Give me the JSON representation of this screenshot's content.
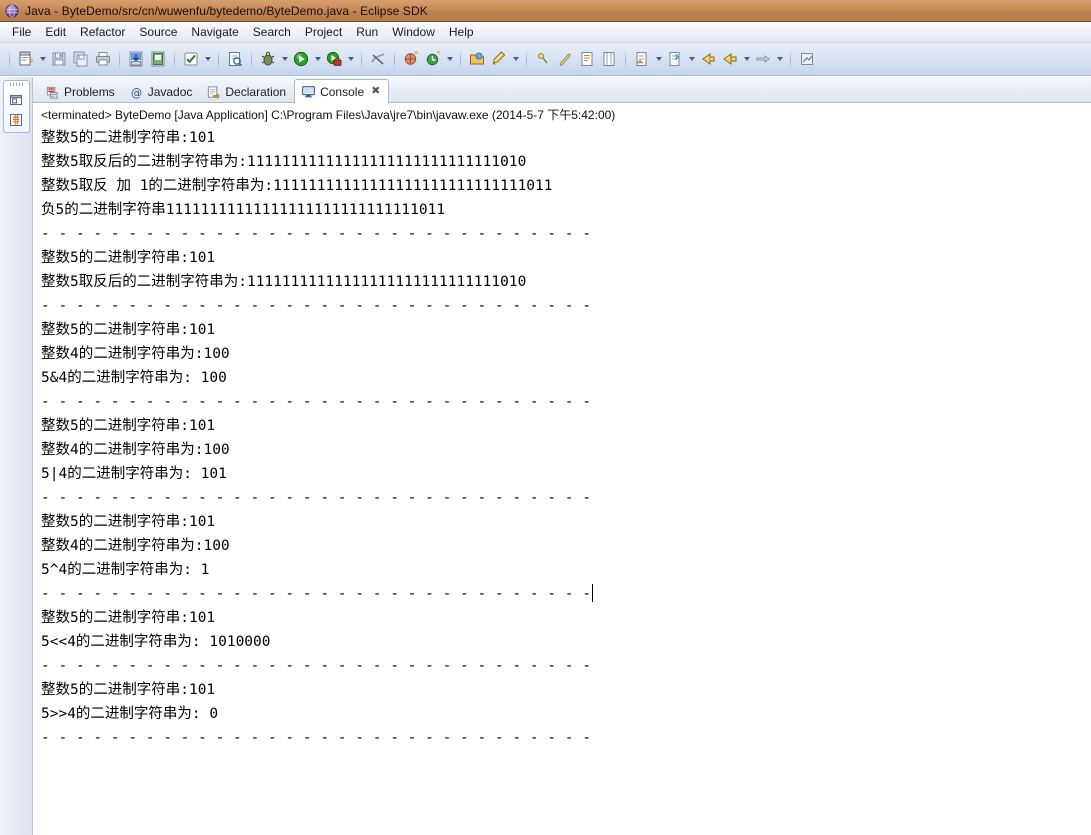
{
  "window": {
    "title": "Java - ByteDemo/src/cn/wuwenfu/bytedemo/ByteDemo.java - Eclipse SDK",
    "app_icon": "eclipse-globe-icon"
  },
  "menubar": {
    "items": [
      {
        "label": "File"
      },
      {
        "label": "Edit"
      },
      {
        "label": "Refactor"
      },
      {
        "label": "Source"
      },
      {
        "label": "Navigate"
      },
      {
        "label": "Search"
      },
      {
        "label": "Project"
      },
      {
        "label": "Run"
      },
      {
        "label": "Window"
      },
      {
        "label": "Help"
      }
    ]
  },
  "toolbar": {
    "groups": [
      {
        "buttons": [
          {
            "icon": "new-wizard-icon",
            "dropdown": true
          },
          {
            "icon": "save-icon",
            "dropdown": false
          },
          {
            "icon": "save-all-icon",
            "dropdown": false
          },
          {
            "icon": "print-icon",
            "dropdown": false
          }
        ]
      },
      {
        "buttons": [
          {
            "icon": "import-icon",
            "dropdown": false
          },
          {
            "icon": "export-icon",
            "dropdown": false
          }
        ]
      },
      {
        "buttons": [
          {
            "icon": "build-all-icon",
            "dropdown": true
          }
        ]
      },
      {
        "buttons": [
          {
            "icon": "open-type-icon",
            "dropdown": false
          }
        ]
      },
      {
        "buttons": [
          {
            "icon": "debug-icon",
            "dropdown": true
          },
          {
            "icon": "run-icon",
            "dropdown": true
          },
          {
            "icon": "external-tools-icon",
            "dropdown": true
          }
        ]
      },
      {
        "buttons": [
          {
            "icon": "skip-breakpoints-icon",
            "dropdown": false
          }
        ]
      },
      {
        "buttons": [
          {
            "icon": "new-java-package-icon",
            "dropdown": false
          },
          {
            "icon": "new-java-class-icon",
            "dropdown": true
          }
        ]
      },
      {
        "buttons": [
          {
            "icon": "open-task-icon",
            "dropdown": false
          },
          {
            "icon": "search-icon",
            "dropdown": true
          }
        ]
      },
      {
        "buttons": [
          {
            "icon": "next-annotation-icon",
            "dropdown": false
          },
          {
            "icon": "previous-annotation-icon",
            "dropdown": false
          },
          {
            "icon": "last-edit-location-icon",
            "dropdown": false
          },
          {
            "icon": "toggle-mark-occurrences-icon",
            "dropdown": false
          }
        ]
      },
      {
        "buttons": [
          {
            "icon": "back-history-icon",
            "dropdown": true
          },
          {
            "icon": "forward-history-icon",
            "dropdown": true
          }
        ]
      },
      {
        "buttons": [
          {
            "icon": "previous-edit-icon",
            "dropdown": false
          },
          {
            "icon": "back-arrow-icon",
            "dropdown": true
          },
          {
            "icon": "forward-arrow-icon",
            "dropdown": true
          }
        ]
      },
      {
        "buttons": [
          {
            "icon": "pin-console-icon",
            "dropdown": false
          }
        ]
      }
    ]
  },
  "fastview": {
    "items": [
      {
        "icon": "restore-perspective-icon"
      },
      {
        "icon": "package-explorer-icon"
      }
    ]
  },
  "view_tabs": [
    {
      "label": "Problems",
      "icon": "problems-icon",
      "active": false,
      "closable": false
    },
    {
      "label": "Javadoc",
      "icon": "javadoc-at-icon",
      "active": false,
      "closable": false
    },
    {
      "label": "Declaration",
      "icon": "declaration-icon",
      "active": false,
      "closable": false
    },
    {
      "label": "Console",
      "icon": "console-icon",
      "active": true,
      "closable": true,
      "close_glyph": "✖"
    }
  ],
  "console": {
    "launch_header": "<terminated> ByteDemo [Java Application] C:\\Program Files\\Java\\jre7\\bin\\javaw.exe (2014-5-7 下午5:42:00)",
    "separator": "- - - - - - - - - - - - - - - - - - - - - - - - - - - - - - - -",
    "lines": [
      "整数5的二进制字符串:101",
      "整数5取反后的二进制字符串为:11111111111111111111111111111010",
      "整数5取反 加 1的二进制字符串为:11111111111111111111111111111011",
      "负5的二进制字符串11111111111111111111111111111011",
      "- - - - - - - - - - - - - - - - - - - - - - - - - - - - - - - -",
      "整数5的二进制字符串:101",
      "整数5取反后的二进制字符串为:11111111111111111111111111111010",
      "- - - - - - - - - - - - - - - - - - - - - - - - - - - - - - - -",
      "整数5的二进制字符串:101",
      "整数4的二进制字符串为:100",
      "5&4的二进制字符串为: 100",
      "- - - - - - - - - - - - - - - - - - - - - - - - - - - - - - - -",
      "整数5的二进制字符串:101",
      "整数4的二进制字符串为:100",
      "5|4的二进制字符串为: 101",
      "- - - - - - - - - - - - - - - - - - - - - - - - - - - - - - - -",
      "整数5的二进制字符串:101",
      "整数4的二进制字符串为:100",
      "5^4的二进制字符串为: 1",
      "- - - - - - - - - - - - - - - - - - - - - - - - - - - - - - - -",
      "整数5的二进制字符串:101",
      "5<<4的二进制字符串为: 1010000",
      "- - - - - - - - - - - - - - - - - - - - - - - - - - - - - - - -",
      "整数5的二进制字符串:101",
      "5>>4的二进制字符串为: 0",
      "- - - - - - - - - - - - - - - - - - - - - - - - - - - - - - - -"
    ],
    "caret_on_line_index": 19
  },
  "colors": {
    "titlebar_start": "#d79f6e",
    "titlebar_end": "#b97b49",
    "toolbar_start": "#e8eef8",
    "toolbar_end": "#c4d3ec",
    "tab_active_bg": "#ffffff",
    "console_bg": "#ffffff",
    "text": "#000000",
    "border": "#a8bad6"
  }
}
